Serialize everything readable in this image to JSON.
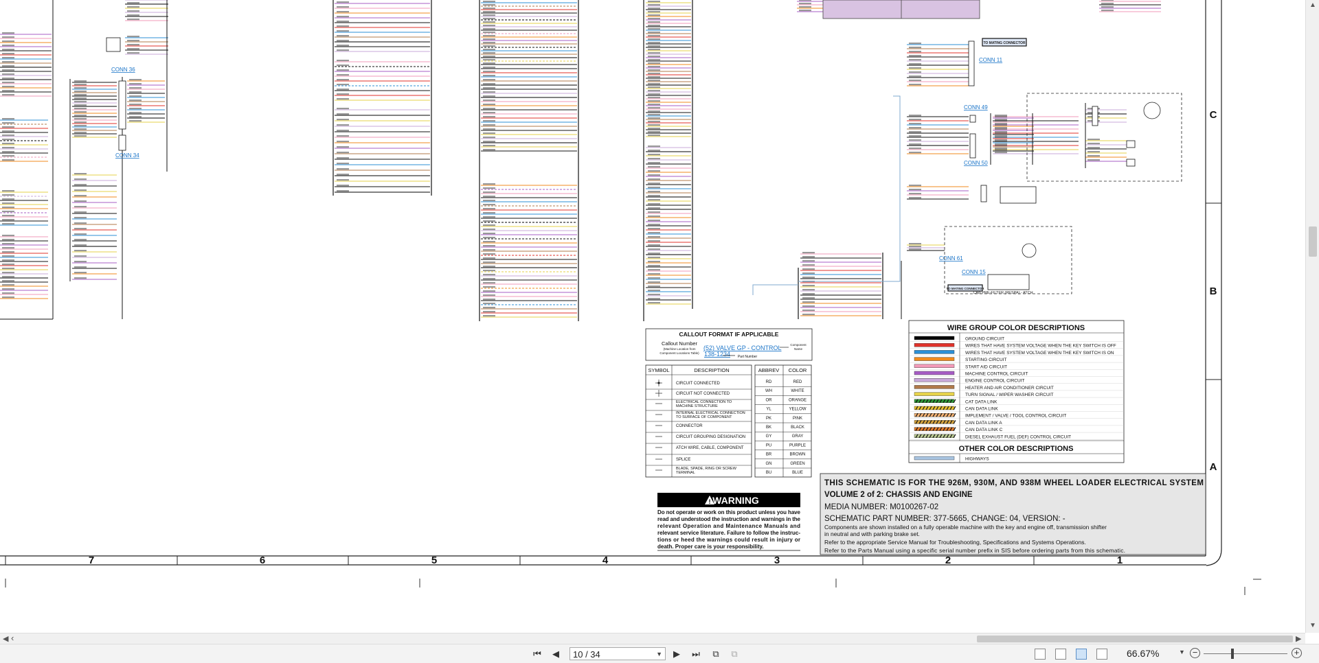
{
  "schematic": {
    "title_block": {
      "line1": "THIS SCHEMATIC IS FOR THE 926M, 930M, AND 938M WHEEL LOADER ELECTRICAL SYSTEM",
      "line2": "VOLUME 2 of 2: CHASSIS AND ENGINE",
      "line3": "MEDIA NUMBER: M0100267-02",
      "line4": "SCHEMATIC PART NUMBER: 377-5665, CHANGE: 04, VERSION: -",
      "note1": "Components are shown installed on a fully operable machine with the key and engine off, transmission shifter",
      "note2": "in neutral and with parking brake set.",
      "note3": "Refer to the appropriate Service Manual for Troubleshooting, Specifications and Systems Operations.",
      "note4": "Refer to the Parts Manual using a specific serial number prefix in SIS before ordering parts from this schematic."
    },
    "warning": {
      "title": "WARNING",
      "line1": "Do not operate or work on this product unless you have",
      "line2": "read and understood the instruction and warnings in the",
      "line3": "relevant Operation and Maintenance Manuals and",
      "line4": "relevant service literature. Failure to follow the instruc-",
      "line5": "tions or heed the warnings could result in injury or",
      "line6": "death. Proper care is your responsibility."
    },
    "callout": {
      "title": "CALLOUT FORMAT IF APPLICABLE",
      "callout_number": "Callout Number",
      "machine_location": "(Machine Location from",
      "component_table": "Component Locations Table)",
      "example_name": "(52) VALVE GP - CONTROL",
      "example_part": "138-1234",
      "component": "Component",
      "name": "Name",
      "part_number": "Part Number"
    },
    "symbol_table": {
      "headers": [
        "SYMBOL",
        "DESCRIPTION"
      ],
      "rows": [
        "CIRCUIT CONNECTED",
        "CIRCUIT NOT CONNECTED",
        "ELECTRICAL CONNECTION TO",
        "MACHINE STRUCTURE",
        "INTERNAL ELECTRICAL CONNECTION",
        "TO SURFACE OF COMPONENT",
        "CONNECTOR",
        "CIRCUIT GROUPING DESIGNATION",
        "ATCH WIRE, CABLE, COMPONENT",
        "SPLICE",
        "BLADE, SPADE, RING OR SCREW",
        "TERMINAL"
      ]
    },
    "abbrev_table": {
      "headers": [
        "ABBREV",
        "COLOR"
      ],
      "rows": [
        [
          "RD",
          "RED"
        ],
        [
          "WH",
          "WHITE"
        ],
        [
          "OR",
          "ORANGE"
        ],
        [
          "YL",
          "YELLOW"
        ],
        [
          "PK",
          "PINK"
        ],
        [
          "BK",
          "BLACK"
        ],
        [
          "GY",
          "GRAY"
        ],
        [
          "PU",
          "PURPLE"
        ],
        [
          "BR",
          "BROWN"
        ],
        [
          "GN",
          "GREEN"
        ],
        [
          "BU",
          "BLUE"
        ]
      ]
    },
    "wire_group": {
      "title": "WIRE GROUP COLOR DESCRIPTIONS",
      "rows": [
        {
          "label": "GROUND CIRCUIT",
          "color": "#000000",
          "pattern": "solid"
        },
        {
          "label": "WIRES THAT HAVE SYSTEM VOLTAGE WHEN THE KEY SWITCH IS OFF",
          "color": "#e0322a",
          "pattern": "solid"
        },
        {
          "label": "WIRES THAT HAVE SYSTEM VOLTAGE WHEN THE KEY SWITCH IS ON",
          "color": "#2b8fd6",
          "pattern": "solid"
        },
        {
          "label": "STARTING CIRCUIT",
          "color": "#f08a1c",
          "pattern": "solid"
        },
        {
          "label": "START AID CIRCUIT",
          "color": "#f29ab8",
          "pattern": "solid"
        },
        {
          "label": "MACHINE CONTROL CIRCUIT",
          "color": "#a75cc5",
          "pattern": "solid"
        },
        {
          "label": "ENGINE CONTROL CIRCUIT",
          "color": "#c8a8d8",
          "pattern": "solid"
        },
        {
          "label": "HEATER AND AIR CONDITIONER CIRCUIT",
          "color": "#b07a4a",
          "pattern": "solid"
        },
        {
          "label": "TURN SIGNAL / WIPER WASHER CIRCUIT",
          "color": "#e6d24a",
          "pattern": "solid"
        },
        {
          "label": "CAT DATA LINK",
          "color": "#2f9a3a",
          "pattern": "striped"
        },
        {
          "label": "CAN DATA LINK",
          "color": "#e8c030",
          "pattern": "striped"
        },
        {
          "label": "IMPLEMENT / VALVE / TOOL CONTROL CIRCUIT",
          "color": "#f2b070",
          "pattern": "striped"
        },
        {
          "label": "CAN DATA LINK A",
          "color": "#d4a23a",
          "pattern": "striped"
        },
        {
          "label": "CAN DATA LINK C",
          "color": "#e07a2a",
          "pattern": "striped"
        },
        {
          "label": "DIESEL EXHAUST FUEL (DEF) CONTROL CIRCUIT",
          "color": "#b8c890",
          "pattern": "striped"
        }
      ],
      "other_title": "OTHER COLOR DESCRIPTIONS",
      "other_rows": [
        {
          "label": "HIGHWAYS",
          "color": "#a8c4e0",
          "pattern": "solid"
        }
      ]
    },
    "border_columns": [
      "7",
      "6",
      "5",
      "4",
      "3",
      "2",
      "1"
    ],
    "border_rows": [
      "C",
      "B",
      "A"
    ],
    "connector_labels": [
      "CONN 36",
      "CONN 34",
      "CONN 11",
      "CONN 49",
      "CONN 50",
      "CONN 61",
      "CONN 15"
    ],
    "highlighted_connectors": [
      "TO MATING CONNECTOR",
      "TO MATING CONNECTOR"
    ],
    "module_label": "CAB PRE-FILTER (RESPA) - ATCH"
  },
  "toolbar": {
    "page_indicator": "10 / 34",
    "zoom_value": "66.67%"
  }
}
